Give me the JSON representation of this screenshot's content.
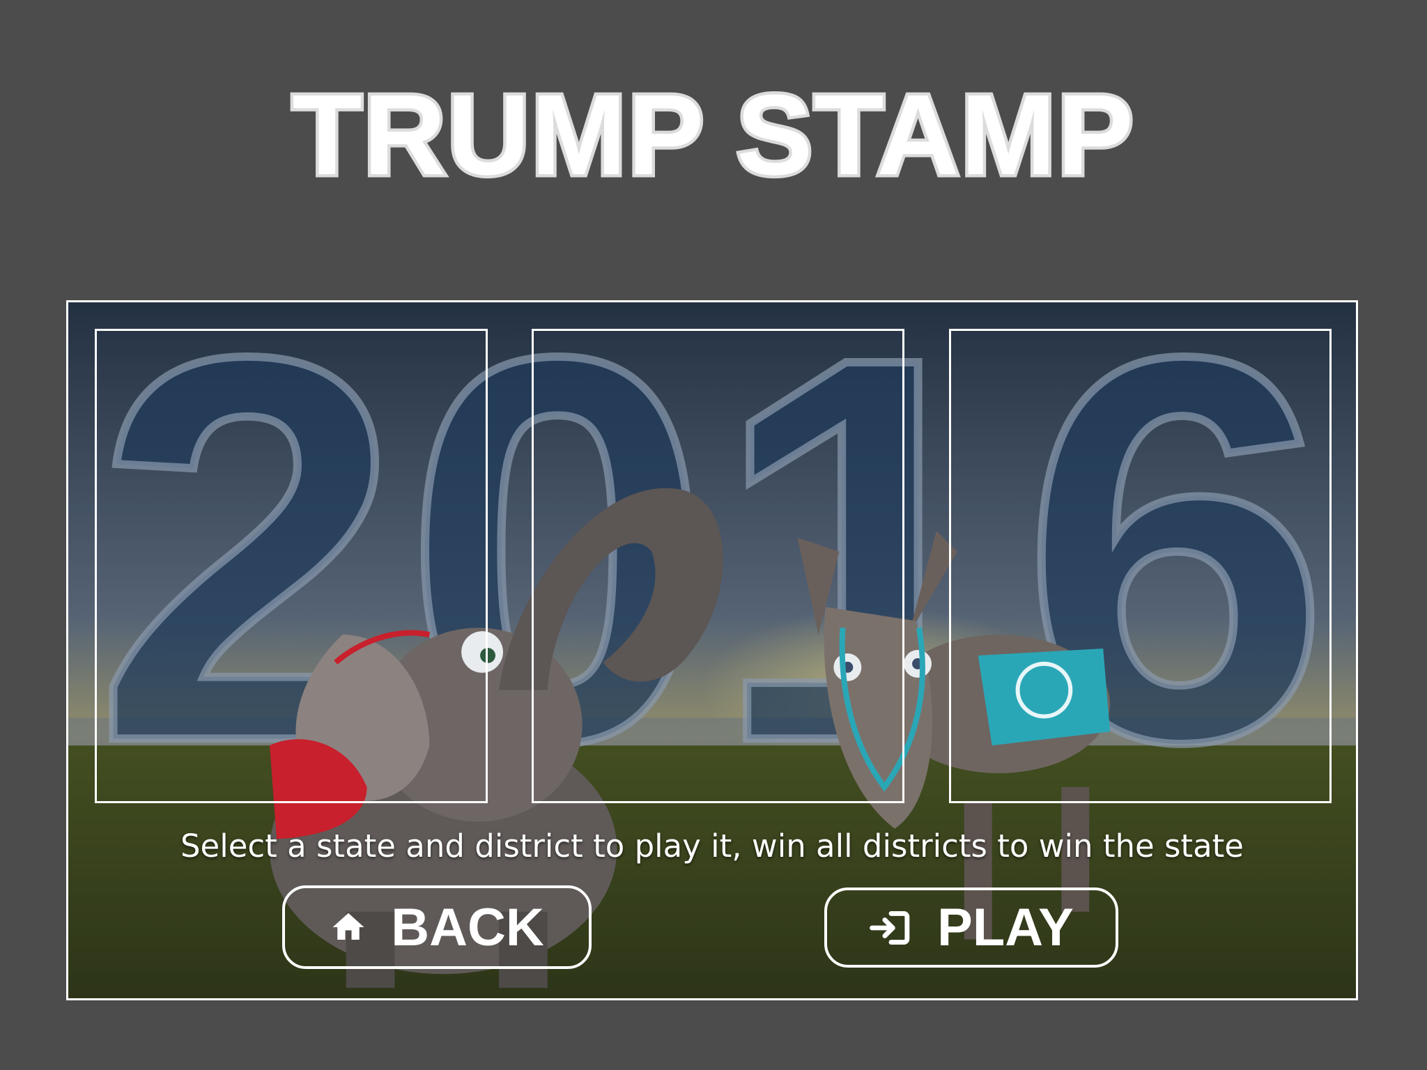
{
  "title": "TRUMP STAMP",
  "scene": {
    "year_text": "2016",
    "parties": [
      "republican-elephant",
      "democratic-donkey"
    ]
  },
  "instructions": "Select a state and district to play it, win all districts to win the state",
  "buttons": {
    "back_label": "BACK",
    "play_label": "PLAY"
  },
  "icons": {
    "back": "home-icon",
    "play": "login-icon"
  },
  "colors": {
    "background": "#4c4c4c",
    "year_fill": "#1e3a5a",
    "gop_red": "#c8202c",
    "dem_teal": "#2aa7b7"
  }
}
